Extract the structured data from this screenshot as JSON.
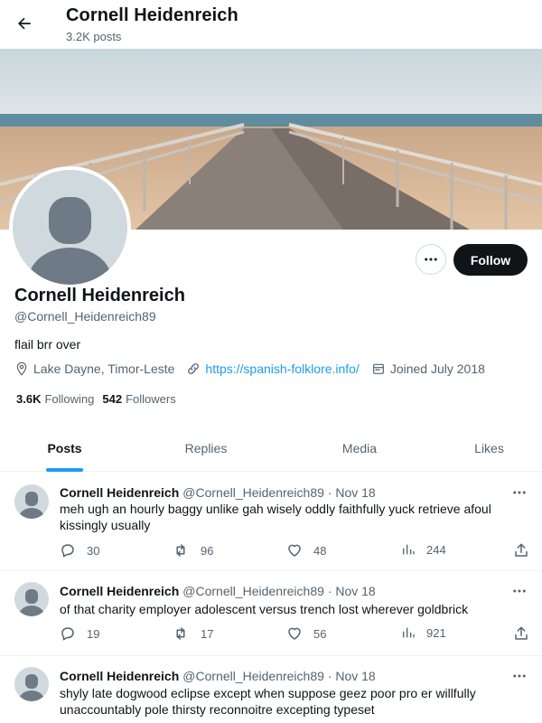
{
  "header": {
    "title": "Cornell Heidenreich",
    "subtitle": "3.2K posts"
  },
  "profile": {
    "name": "Cornell Heidenreich",
    "handle": "@Cornell_Heidenreich89",
    "bio": "flail brr over",
    "location": "Lake Dayne, Timor-Leste",
    "link": "https://spanish-folklore.info/",
    "joined": "Joined July 2018",
    "following_count": "3.6K",
    "following_label": "Following",
    "followers_count": "542",
    "followers_label": "Followers",
    "follow_button": "Follow"
  },
  "tabs": [
    {
      "label": "Posts",
      "active": true
    },
    {
      "label": "Replies",
      "active": false
    },
    {
      "label": "Media",
      "active": false
    },
    {
      "label": "Likes",
      "active": false
    }
  ],
  "tweets": [
    {
      "name": "Cornell Heidenreich",
      "handle": "@Cornell_Heidenreich89",
      "date": "· Nov 18",
      "text": "meh ugh an hourly baggy unlike gah wisely oddly faithfully yuck retrieve afoul kissingly usually",
      "replies": "30",
      "reposts": "96",
      "likes": "48",
      "views": "244"
    },
    {
      "name": "Cornell Heidenreich",
      "handle": "@Cornell_Heidenreich89",
      "date": "· Nov 18",
      "text": "of that charity employer adolescent versus trench lost wherever goldbrick",
      "replies": "19",
      "reposts": "17",
      "likes": "56",
      "views": "921"
    },
    {
      "name": "Cornell Heidenreich",
      "handle": "@Cornell_Heidenreich89",
      "date": "· Nov 18",
      "text": "shyly late dogwood eclipse except when suppose geez poor pro er willfully unaccountably pole thirsty reconnoitre excepting typeset",
      "replies": "",
      "reposts": "",
      "likes": "",
      "views": ""
    }
  ],
  "icons": {
    "back": "arrow-left-icon",
    "more": "more-horizontal-icon",
    "location": "location-pin-icon",
    "link": "link-icon",
    "calendar": "calendar-icon",
    "reply": "reply-icon",
    "repost": "repost-icon",
    "like": "heart-icon",
    "views": "views-icon",
    "share": "share-icon"
  },
  "colors": {
    "accent": "#1d9bf0",
    "text": "#0f1419",
    "secondary": "#536471",
    "border": "#eff3f4",
    "avatar_bg": "#cfd9de",
    "button_dark": "#0f1419"
  }
}
